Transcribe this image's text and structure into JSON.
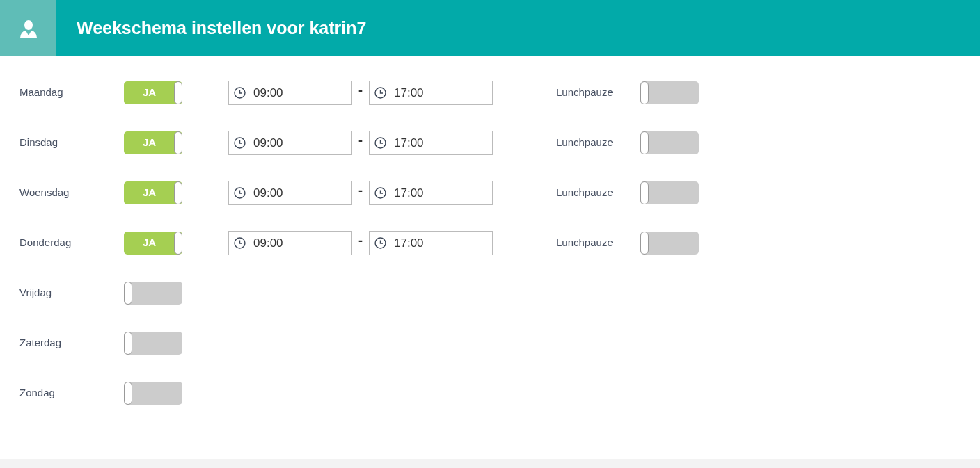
{
  "header": {
    "title": "Weekschema instellen voor katrin7"
  },
  "days": [
    {
      "name": "Maandag",
      "on": true,
      "toggle_label": "JA",
      "start": "09:00",
      "separator": "-",
      "end": "17:00",
      "lunch_label": "Lunchpauze",
      "lunch_on": false
    },
    {
      "name": "Dinsdag",
      "on": true,
      "toggle_label": "JA",
      "start": "09:00",
      "separator": "-",
      "end": "17:00",
      "lunch_label": "Lunchpauze",
      "lunch_on": false
    },
    {
      "name": "Woensdag",
      "on": true,
      "toggle_label": "JA",
      "start": "09:00",
      "separator": "-",
      "end": "17:00",
      "lunch_label": "Lunchpauze",
      "lunch_on": false
    },
    {
      "name": "Donderdag",
      "on": true,
      "toggle_label": "JA",
      "start": "09:00",
      "separator": "-",
      "end": "17:00",
      "lunch_label": "Lunchpauze",
      "lunch_on": false
    },
    {
      "name": "Vrijdag",
      "on": false
    },
    {
      "name": "Zaterdag",
      "on": false
    },
    {
      "name": "Zondag",
      "on": false
    }
  ]
}
